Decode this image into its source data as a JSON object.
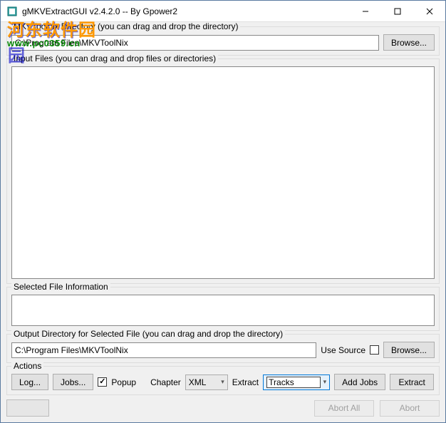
{
  "window": {
    "title": "gMKVExtractGUI v2.4.2.0 -- By Gpower2"
  },
  "watermark": {
    "cn": "河东软件园",
    "sub": "www.pc0359.cn"
  },
  "mkvtoolnix": {
    "legend": "MKVToolnix Directory (you can drag and drop the directory)",
    "path": "C:\\Program Files\\MKVToolNix",
    "browse": "Browse..."
  },
  "input": {
    "legend": "Input Files (you can drag and drop files or directories)"
  },
  "fileinfo": {
    "legend": "Selected File Information"
  },
  "output": {
    "legend": "Output Directory for Selected File (you can drag and drop the directory)",
    "path": "C:\\Program Files\\MKVToolNix",
    "use_source": "Use Source",
    "browse": "Browse..."
  },
  "actions": {
    "legend": "Actions",
    "log": "Log...",
    "jobs": "Jobs...",
    "popup": "Popup",
    "chapter": "Chapter",
    "chapter_format": "XML",
    "extract_label": "Extract",
    "extract_mode": "Tracks",
    "add_jobs": "Add Jobs",
    "extract_btn": "Extract"
  },
  "footer": {
    "abort_all": "Abort All",
    "abort": "Abort"
  }
}
